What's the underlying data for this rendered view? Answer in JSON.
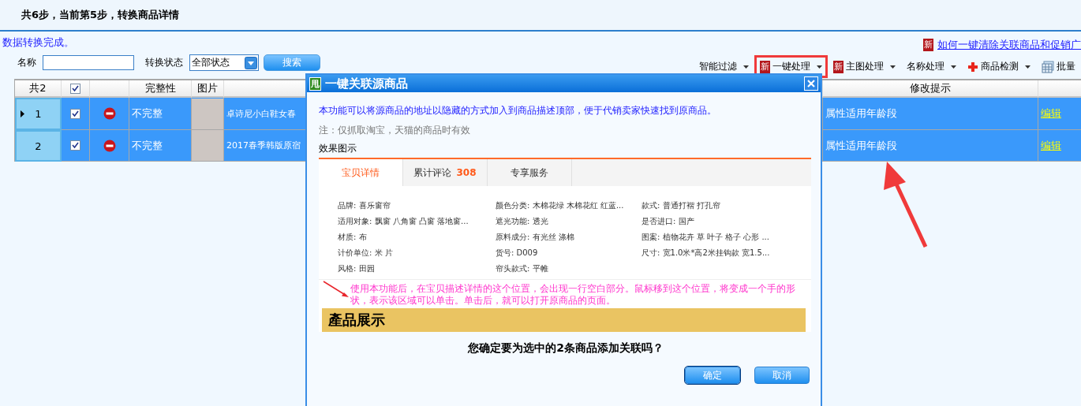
{
  "header": {
    "title": "共6步，当前第5步，转换商品详情"
  },
  "status_message": "数据转换完成。",
  "search": {
    "name_label": "名称",
    "status_label": "转换状态",
    "status_value": "全部状态",
    "button": "搜索"
  },
  "help_link": {
    "badge": "新",
    "text": "如何一键清除关联商品和促销广"
  },
  "toolbar": [
    {
      "kind": "plain",
      "label": "智能过滤",
      "caret": true,
      "highlighted": false
    },
    {
      "kind": "badge",
      "badge": "新",
      "label": "一键处理",
      "caret": true,
      "highlighted": true
    },
    {
      "kind": "badge",
      "badge": "新",
      "label": "主图处理",
      "caret": true,
      "highlighted": false
    },
    {
      "kind": "plain",
      "label": "名称处理",
      "caret": true,
      "highlighted": false
    },
    {
      "kind": "cross",
      "label": "商品检测",
      "caret": true,
      "highlighted": false
    },
    {
      "kind": "grid",
      "label": "批量",
      "caret": false,
      "highlighted": false
    }
  ],
  "table": {
    "count": "共2",
    "select_all_checked": true,
    "columns": [
      "完整性",
      "图片",
      "修改提示"
    ],
    "rows": [
      {
        "number": "1",
        "current": true,
        "selected": true,
        "checked": true,
        "completeness": "不完整",
        "name": "卓诗尼小白鞋女春",
        "hint": "属性适用年龄段",
        "action": "编辑"
      },
      {
        "number": "2",
        "current": false,
        "selected": true,
        "checked": true,
        "completeness": "不完整",
        "name": "2017春季韩版原宿",
        "hint": "属性适用年龄段",
        "action": "编辑"
      }
    ]
  },
  "dialog": {
    "badge": "甩",
    "title": "一键关联源商品",
    "intro": "本功能可以将源商品的地址以隐藏的方式加入到商品描述顶部，便于代销卖家快速找到原商品。",
    "note": "注：仅抓取淘宝，天猫的商品时有效",
    "preview_label": "效果图示",
    "preview": {
      "tabs": [
        {
          "label": "宝贝详情",
          "selected": true
        },
        {
          "label": "累计评论",
          "count": "308",
          "selected": false
        },
        {
          "label": "专享服务",
          "selected": false
        }
      ],
      "attributes": [
        "品牌: 喜乐窗帘",
        "颜色分类: 木棉花绿 木棉花红 红蓝...",
        "款式: 普通打褶 打孔帘",
        "适用对象: 飘窗 八角窗 凸窗 落地窗...",
        "遮光功能: 透光",
        "是否进口: 国产",
        "材质: 布",
        "原料成分: 有光丝 涤棉",
        "图案: 植物花卉 草 叶子 格子 心形 ...",
        "计价单位: 米 片",
        "货号: D009",
        "尺寸: 宽1.0米*高2米挂钩款 宽1.5...",
        "风格: 田园",
        "帘头款式: 平帷"
      ],
      "annotation": "使用本功能后，在宝贝描述详情的这个位置，会出现一行空白部分。鼠标移到这个位置，将变成一个手的形状，表示该区域可以单击。单击后，就可以打开原商品的页面。",
      "banner": "產品展示"
    },
    "question": "您确定要为选中的2条商品添加关联吗？",
    "buttons": [
      {
        "label": "确定",
        "selected": true
      },
      {
        "label": "取消",
        "selected": false
      }
    ]
  }
}
